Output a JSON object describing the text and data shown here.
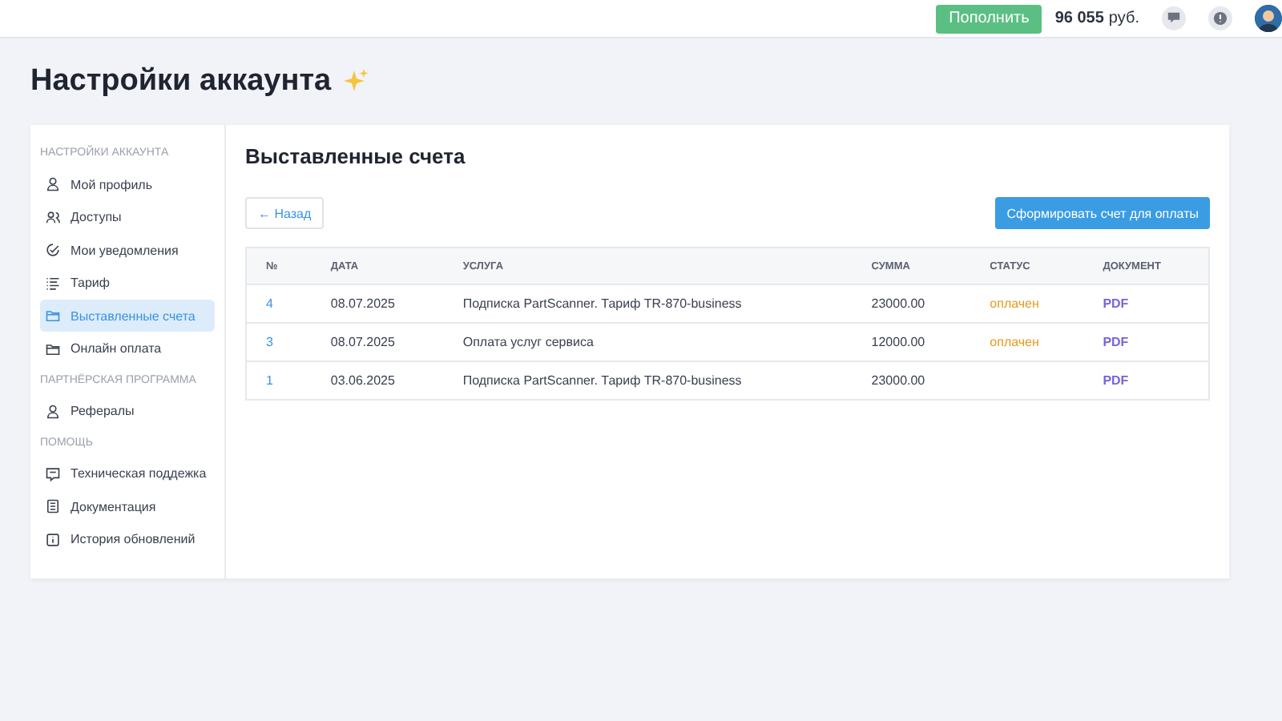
{
  "top_bar": {
    "topup_button": "Пополнить",
    "balance_amount": "96 055",
    "balance_currency": "руб."
  },
  "page_title": "Настройки аккаунта",
  "sidebar": {
    "sections": [
      {
        "title": "НАСТРОЙКИ АККАУНТА",
        "items": [
          {
            "label": "Мой профиль",
            "selected": false
          },
          {
            "label": "Доступы",
            "selected": false
          },
          {
            "label": "Мои уведомления",
            "selected": false
          },
          {
            "label": "Тариф",
            "selected": false
          },
          {
            "label": "Выставленные счета",
            "selected": true
          },
          {
            "label": "Онлайн оплата",
            "selected": false
          }
        ]
      },
      {
        "title": "ПАРТНЁРСКАЯ ПРОГРАММА",
        "items": [
          {
            "label": "Рефералы",
            "selected": false
          }
        ]
      },
      {
        "title": "ПОМОЩЬ",
        "items": [
          {
            "label": "Техническая поддежка",
            "selected": false
          },
          {
            "label": "Документация",
            "selected": false
          },
          {
            "label": "История обновлений",
            "selected": false
          }
        ]
      }
    ]
  },
  "content": {
    "title": "Выставленные счета",
    "back_button": "← Назад",
    "create_button": "Сформировать счет для оплаты",
    "table": {
      "columns": [
        "№",
        "ДАТА",
        "УСЛУГА",
        "СУММА",
        "СТАТУС",
        "ДОКУМЕНТ"
      ],
      "rows": [
        {
          "number": "4",
          "date": "08.07.2025",
          "service": "Подписка PartScanner. Тариф TR-870-business",
          "amount": "23000.00",
          "status": "оплачен",
          "document": "PDF"
        },
        {
          "number": "3",
          "date": "08.07.2025",
          "service": "Оплата услуг сервиса",
          "amount": "12000.00",
          "status": "оплачен",
          "document": "PDF"
        },
        {
          "number": "1",
          "date": "03.06.2025",
          "service": "Подписка PartScanner. Тариф TR-870-business",
          "amount": "23000.00",
          "document": "PDF"
        }
      ]
    }
  }
}
